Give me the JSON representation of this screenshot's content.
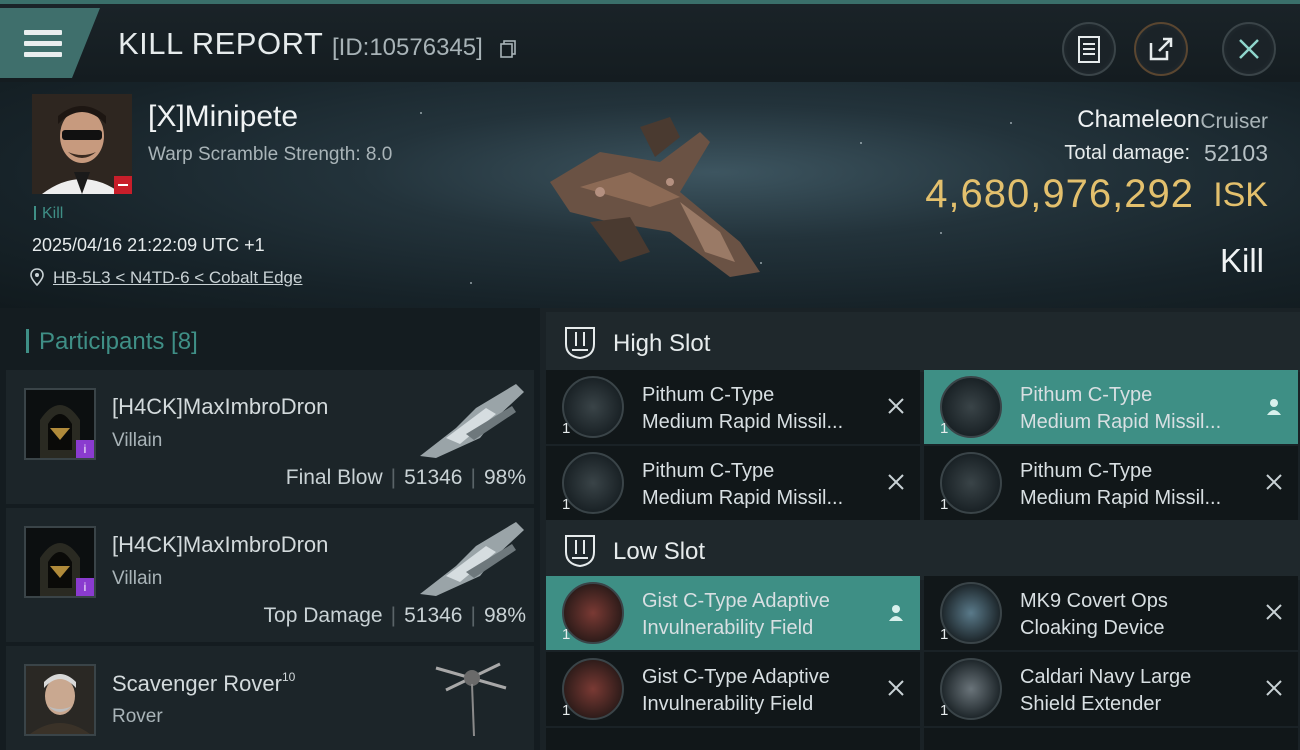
{
  "header": {
    "title": "KILL REPORT",
    "id_text": "[ID:10576345]",
    "buttons": [
      "clipboard-icon",
      "share-icon",
      "close-icon"
    ]
  },
  "victim": {
    "name": "[X]Minipete",
    "warp_scramble": "Warp Scramble Strength: 8.0",
    "kill_tag": "Kill",
    "datetime": "2025/04/16 21:22:09 UTC +1",
    "location": "HB-5L3 < N4TD-6 < Cobalt Edge",
    "ship_name": "Chameleon",
    "ship_class": "Cruiser",
    "total_damage_label": "Total damage:",
    "total_damage": "52103",
    "isk_value": "4,680,976,292",
    "isk_unit": "ISK",
    "result": "Kill"
  },
  "participants": {
    "title": "Participants [8]",
    "rows": [
      {
        "name": "[H4CK]MaxImbroDron",
        "role": "Villain",
        "stat_label": "Final Blow",
        "damage": "51346",
        "percent": "98%"
      },
      {
        "name": "[H4CK]MaxImbroDron",
        "role": "Villain",
        "stat_label": "Top Damage",
        "damage": "51346",
        "percent": "98%"
      },
      {
        "name": "Scavenger Rover",
        "level": "10",
        "role": "Rover"
      }
    ]
  },
  "slots": {
    "high": {
      "label": "High Slot",
      "items": [
        {
          "qty": "1",
          "line1": "Pithum C-Type",
          "line2": "Medium Rapid Missil...",
          "status": "destroyed"
        },
        {
          "qty": "1",
          "line1": "Pithum C-Type",
          "line2": "Medium Rapid Missil...",
          "status": "dropped"
        },
        {
          "qty": "1",
          "line1": "Pithum C-Type",
          "line2": "Medium Rapid Missil...",
          "status": "destroyed"
        },
        {
          "qty": "1",
          "line1": "Pithum C-Type",
          "line2": "Medium Rapid Missil...",
          "status": "destroyed"
        }
      ]
    },
    "low": {
      "label": "Low Slot",
      "items": [
        {
          "qty": "1",
          "line1": "Gist C-Type Adaptive",
          "line2": "Invulnerability Field",
          "status": "dropped"
        },
        {
          "qty": "1",
          "line1": "MK9 Covert Ops",
          "line2": "Cloaking Device",
          "status": "destroyed"
        },
        {
          "qty": "1",
          "line1": "Gist C-Type Adaptive",
          "line2": "Invulnerability Field",
          "status": "destroyed"
        },
        {
          "qty": "1",
          "line1": "Caldari Navy Large",
          "line2": "Shield Extender",
          "status": "destroyed"
        }
      ]
    }
  },
  "colors": {
    "accent": "#3e8f85",
    "isk": "#e3c06d"
  }
}
